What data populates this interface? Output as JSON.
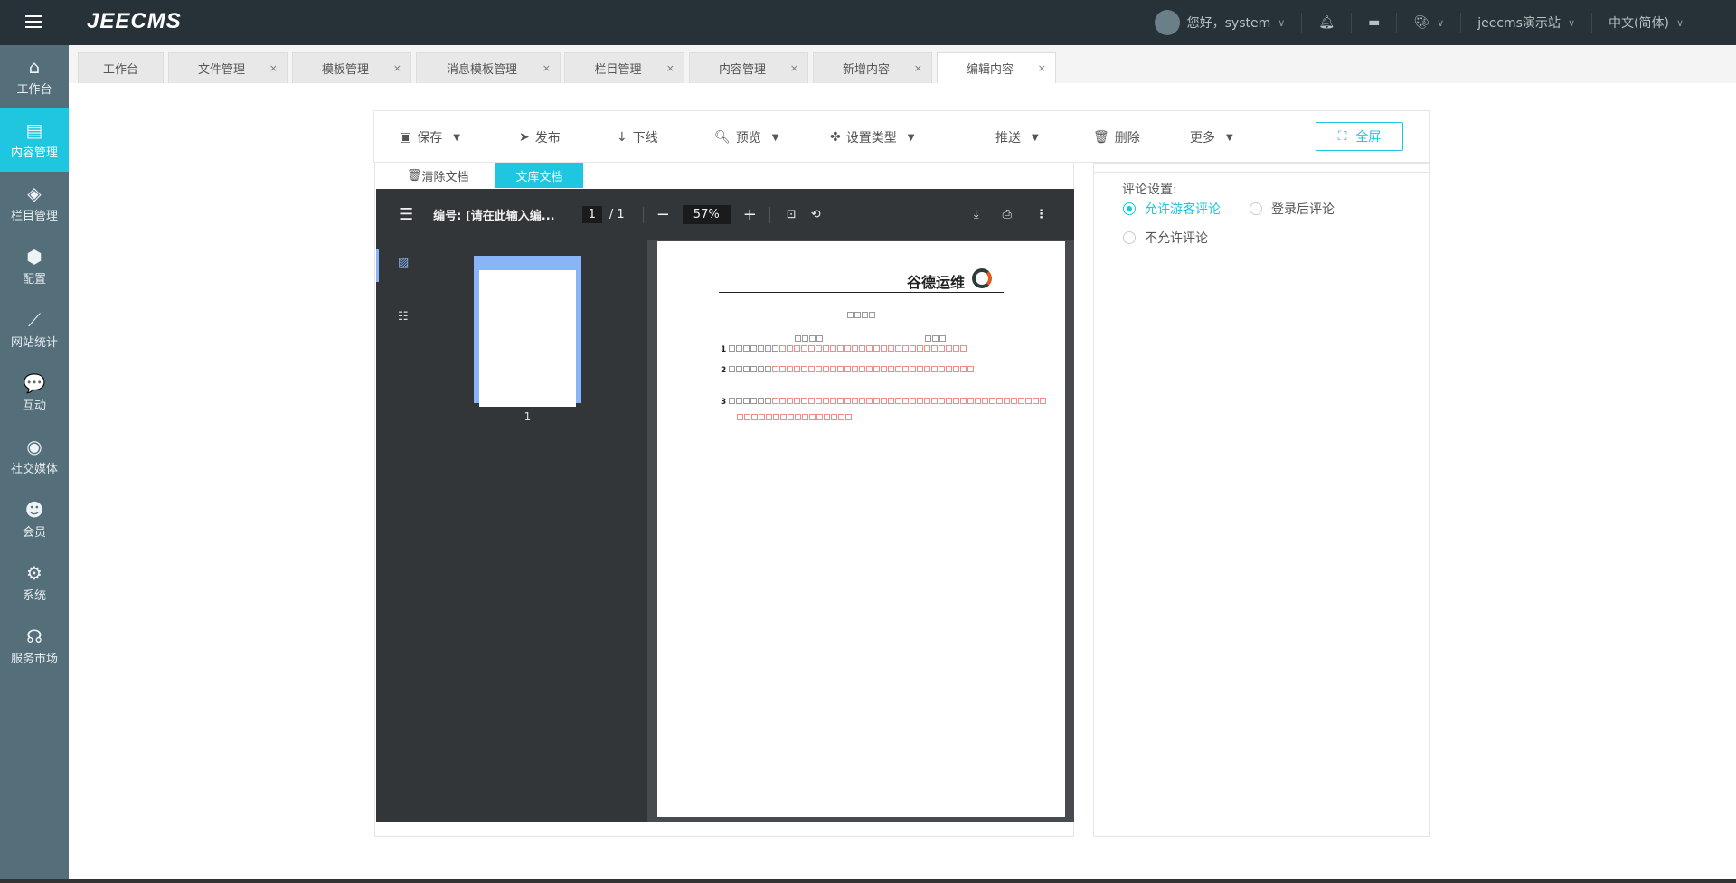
{
  "header": {
    "logo": "JEECMS",
    "greeting": "您好，system",
    "site": "jeecms演示站",
    "language": "中文(简体)"
  },
  "sidebar": {
    "items": [
      {
        "label": "工作台",
        "icon": "home-icon",
        "glyph": "⌂"
      },
      {
        "label": "内容管理",
        "icon": "document-edit-icon",
        "glyph": "▤",
        "active": true
      },
      {
        "label": "栏目管理",
        "icon": "layers-icon",
        "glyph": "◈"
      },
      {
        "label": "配置",
        "icon": "cube-icon",
        "glyph": "⬢"
      },
      {
        "label": "网站统计",
        "icon": "line-chart-icon",
        "glyph": "⟋"
      },
      {
        "label": "互动",
        "icon": "chat-icon",
        "glyph": "💬"
      },
      {
        "label": "社交媒体",
        "icon": "target-icon",
        "glyph": "◉"
      },
      {
        "label": "会员",
        "icon": "member-icon",
        "glyph": "☻"
      },
      {
        "label": "系统",
        "icon": "gear-icon",
        "glyph": "⚙"
      },
      {
        "label": "服务市场",
        "icon": "headset-icon",
        "glyph": "☊"
      }
    ]
  },
  "tabs": [
    "工作台",
    "文件管理",
    "模板管理",
    "消息模板管理",
    "栏目管理",
    "内容管理",
    "新增内容",
    "编辑内容"
  ],
  "toolbar": {
    "save": "保存",
    "publish": "发布",
    "offline": "下线",
    "preview": "预览",
    "set_type": "设置类型",
    "push": "推送",
    "delete": "删除",
    "more": "更多",
    "fullscreen": "全屏"
  },
  "doc": {
    "clear": "清除文档",
    "library": "文库文档"
  },
  "viewer": {
    "title": "编号: [请在此输入编...",
    "page": "1",
    "total": "/ 1",
    "zoom": "57%",
    "thumb_label": "1",
    "logo_text": "谷德运维"
  },
  "comments": {
    "label": "评论设置:",
    "options": [
      "允许游客评论",
      "登录后评论",
      "不允许评论"
    ],
    "selected": 0
  },
  "colors": {
    "accent": "#1ec6e0",
    "header": "#263238",
    "sidebar": "#546e7a"
  }
}
